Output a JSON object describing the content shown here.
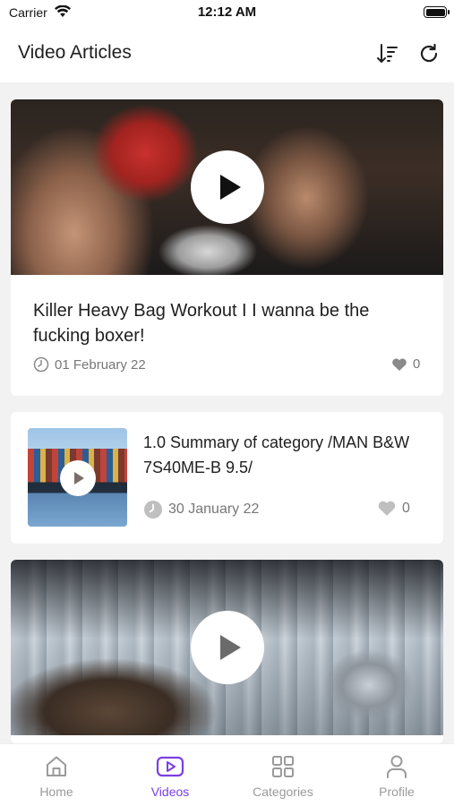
{
  "status_bar": {
    "carrier": "Carrier",
    "time": "12:12 AM"
  },
  "header": {
    "title": "Video Articles",
    "sort_icon": "sort-icon",
    "refresh_icon": "refresh-icon"
  },
  "articles": [
    {
      "title": "Killer Heavy Bag Workout I I wanna be the fucking boxer!",
      "date": "01 February 22",
      "likes": "0",
      "layout": "large"
    },
    {
      "title": "1.0 Summary of category /MAN B&W 7S40ME-B 9.5/",
      "date": "30 January 22",
      "likes": "0",
      "layout": "compact"
    },
    {
      "title": "",
      "date": "",
      "likes": "",
      "layout": "large"
    }
  ],
  "tabs": [
    {
      "label": "Home",
      "icon": "home-icon",
      "active": false
    },
    {
      "label": "Videos",
      "icon": "play-square-icon",
      "active": true
    },
    {
      "label": "Categories",
      "icon": "grid-icon",
      "active": false
    },
    {
      "label": "Profile",
      "icon": "user-icon",
      "active": false
    }
  ],
  "colors": {
    "accent": "#7b3fe4",
    "inactive": "#9a9a9a",
    "background": "#f2f2f2",
    "card": "#ffffff"
  }
}
